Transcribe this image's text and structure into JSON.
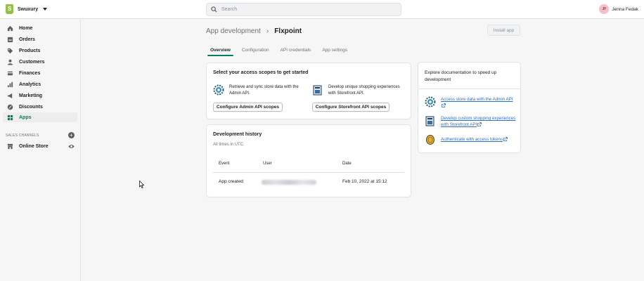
{
  "store": {
    "name": "Swuxury"
  },
  "search": {
    "placeholder": "Search"
  },
  "user": {
    "initials": "JF",
    "name": "Jenna Fedak"
  },
  "sidebar": {
    "items": [
      {
        "label": "Home",
        "icon": "home-icon"
      },
      {
        "label": "Orders",
        "icon": "orders-icon"
      },
      {
        "label": "Products",
        "icon": "tag-icon"
      },
      {
        "label": "Customers",
        "icon": "person-icon"
      },
      {
        "label": "Finances",
        "icon": "finances-icon"
      },
      {
        "label": "Analytics",
        "icon": "bar-chart-icon"
      },
      {
        "label": "Marketing",
        "icon": "megaphone-icon"
      },
      {
        "label": "Discounts",
        "icon": "discount-icon"
      },
      {
        "label": "Apps",
        "icon": "apps-grid-icon",
        "active": true
      }
    ],
    "sales_channels_label": "SALES CHANNELS",
    "online_store_label": "Online Store"
  },
  "page": {
    "breadcrumb_parent": "App development",
    "title": "Flxpoint",
    "install_label": "Install app",
    "tabs": [
      "Overview",
      "Configuration",
      "API credentials",
      "App settings"
    ]
  },
  "scopes": {
    "title": "Select your access scopes to get started",
    "admin_text": "Retrieve and sync store data with the Admin API.",
    "storefront_text": "Develop unique shopping experiences with Storefront API.",
    "admin_button": "Configure Admin API scopes",
    "storefront_button": "Configure Storefront API scopes"
  },
  "history": {
    "title": "Development history",
    "subtitle": "All times in UTC.",
    "columns": [
      "Event",
      "User",
      "Date"
    ],
    "rows": [
      {
        "event": "App created",
        "date": "Feb 10, 2022 at 15:12"
      }
    ]
  },
  "docs": {
    "heading": "Explore documentation to speed up development",
    "links": [
      "Access store data with the Admin API",
      "Develop custom shopping experiences with Storefront API",
      "Authenticate with access tokens"
    ]
  },
  "colors": {
    "accent": "#008060",
    "link": "#2c6ecb"
  }
}
